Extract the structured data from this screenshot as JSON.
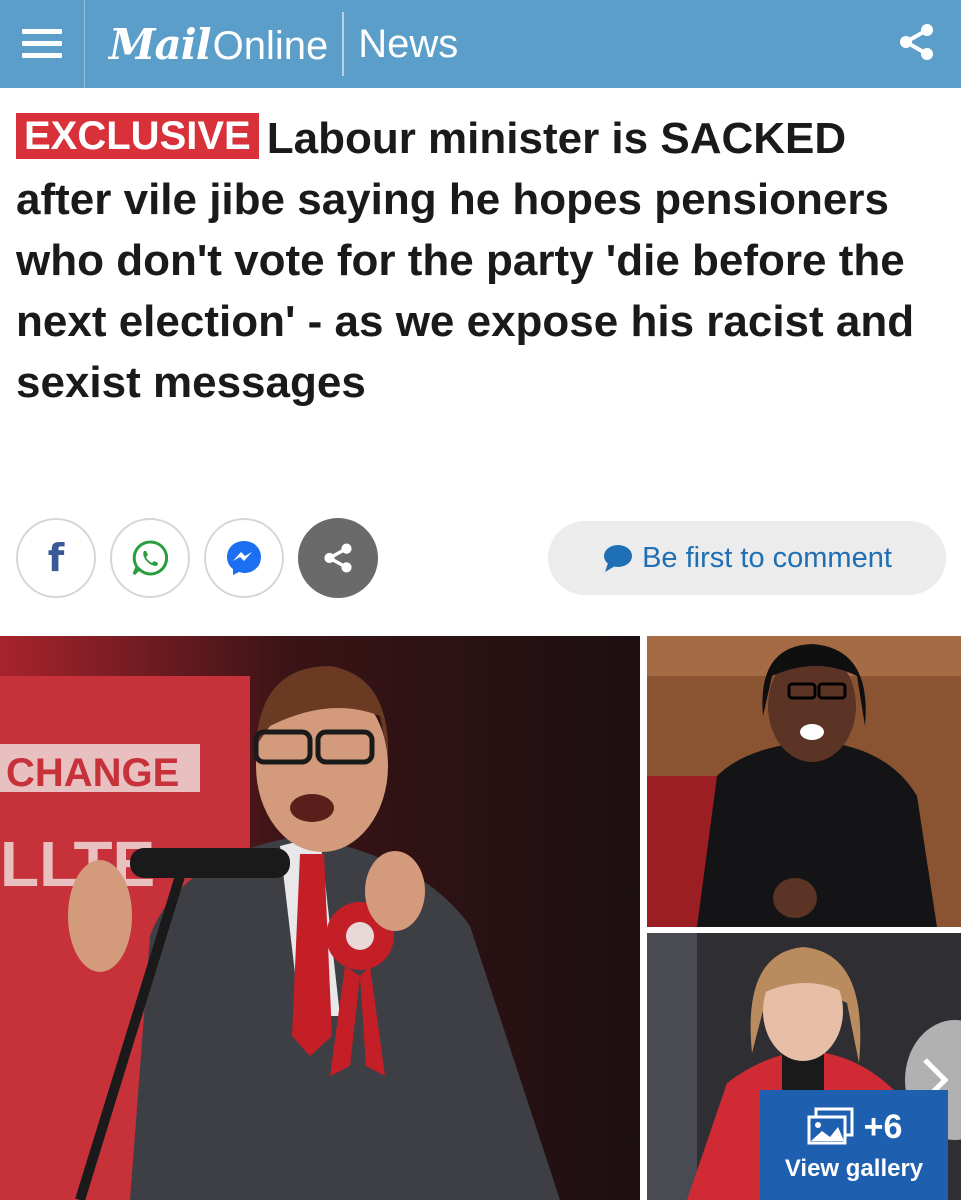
{
  "header": {
    "logo_mail": "Mail",
    "logo_online": "Online",
    "section": "News",
    "bg_color": "#5b9ec9"
  },
  "article": {
    "badge": "EXCLUSIVE",
    "headline": "Labour minister is SACKED after vile jibe saying he hopes pensioners who don't vote for the party 'die before the next election' - as we expose his racist and sexist messages"
  },
  "social": {
    "facebook_glyph": "f",
    "icons": [
      "facebook-icon",
      "whatsapp-icon",
      "messenger-icon",
      "share-icon"
    ],
    "comment_label": "Be first to comment"
  },
  "gallery": {
    "count": "+6",
    "label": "View gallery",
    "banner_text_1": "CHANGE",
    "banner_text_2": "LLTE"
  },
  "colors": {
    "badge_red": "#d9313a",
    "link_blue": "#1f6fb4",
    "gallery_blue": "#1f5fb0"
  }
}
